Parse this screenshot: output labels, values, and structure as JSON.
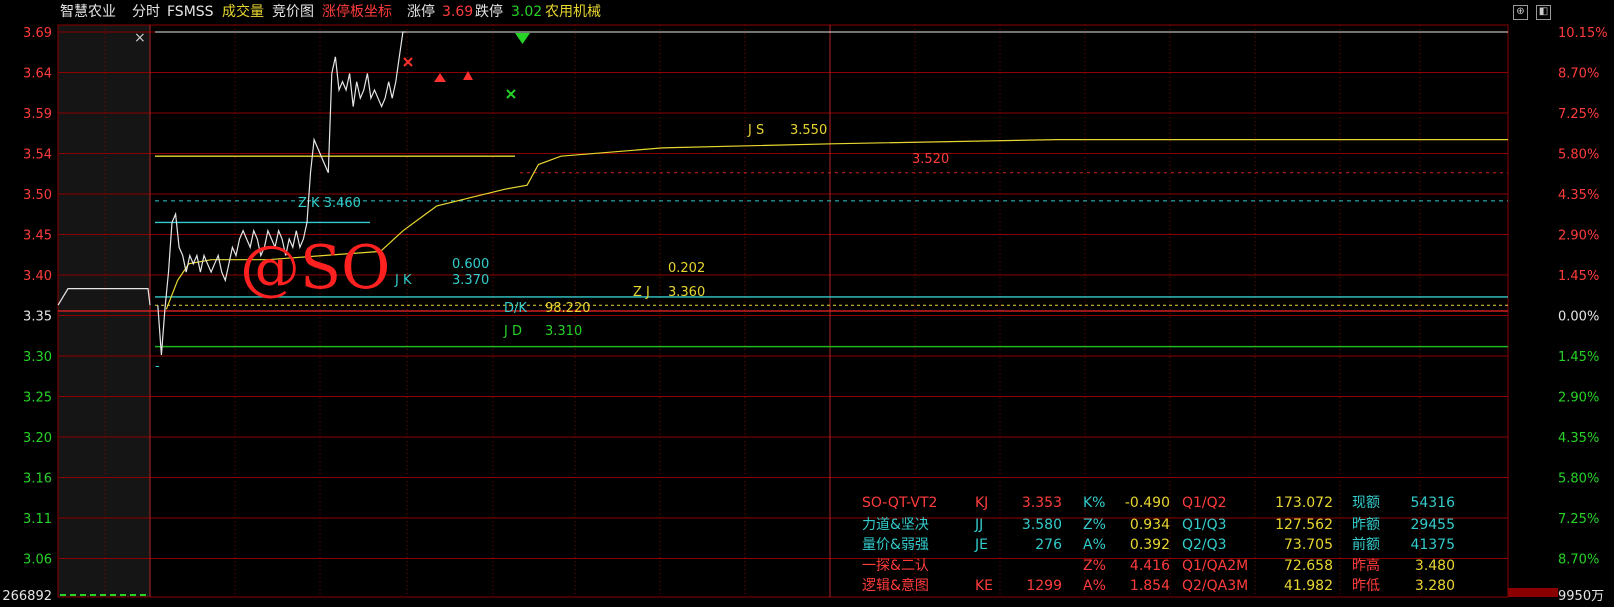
{
  "header": {
    "stock_name": "智慧农业",
    "mode": "分时",
    "indicator": "FSMSS",
    "volume_label": "成交量",
    "auction_label": "竞价图",
    "limit_board_label": "涨停板坐标",
    "limit_up_label": "涨停",
    "limit_up_value": "3.69",
    "limit_down_label": "跌停",
    "limit_down_value": "3.02",
    "sector": "农用机械"
  },
  "colors": {
    "background": "#000000",
    "price_line": "#e6e6e6",
    "avg_line": "#e8d630",
    "grid": "#8b0000",
    "up": "#ff3c3c",
    "down": "#27d327",
    "cyan": "#33cccc",
    "green_line": "#1fb51f"
  },
  "icons": {
    "close": "close-icon",
    "restore": "restore-icon",
    "maximize": "maximize-icon",
    "close_glyph": "×"
  },
  "chart_data": {
    "type": "line",
    "prev_close": 3.353,
    "ylim": [
      3.02,
      3.69
    ],
    "y_ticks_left": [
      "3.69",
      "3.64",
      "3.59",
      "3.54",
      "3.50",
      "3.45",
      "3.40",
      "3.35",
      "3.30",
      "3.25",
      "3.20",
      "3.16",
      "3.11",
      "3.06"
    ],
    "y_ticks_right": [
      "10.15%",
      "8.70%",
      "7.25%",
      "5.80%",
      "4.35%",
      "2.90%",
      "1.45%",
      "0.00%",
      "1.45%",
      "2.90%",
      "4.35%",
      "5.80%",
      "7.25%",
      "8.70%"
    ],
    "volume_axis_label": "266892",
    "volume_axis_right": "9950万",
    "series": [
      {
        "name": "price",
        "points": [
          [
            0,
            3.36
          ],
          [
            1,
            3.3
          ],
          [
            2,
            3.355
          ],
          [
            3,
            3.4
          ],
          [
            4,
            3.46
          ],
          [
            5,
            3.47
          ],
          [
            6,
            3.43
          ],
          [
            7,
            3.42
          ],
          [
            8,
            3.4
          ],
          [
            9,
            3.42
          ],
          [
            10,
            3.41
          ],
          [
            11,
            3.42
          ],
          [
            12,
            3.4
          ],
          [
            13,
            3.42
          ],
          [
            14,
            3.41
          ],
          [
            15,
            3.4
          ],
          [
            16,
            3.41
          ],
          [
            17,
            3.42
          ],
          [
            18,
            3.4
          ],
          [
            19,
            3.39
          ],
          [
            20,
            3.41
          ],
          [
            21,
            3.43
          ],
          [
            22,
            3.42
          ],
          [
            23,
            3.44
          ],
          [
            24,
            3.45
          ],
          [
            25,
            3.44
          ],
          [
            26,
            3.43
          ],
          [
            27,
            3.45
          ],
          [
            28,
            3.44
          ],
          [
            29,
            3.42
          ],
          [
            30,
            3.43
          ],
          [
            31,
            3.45
          ],
          [
            32,
            3.44
          ],
          [
            33,
            3.43
          ],
          [
            34,
            3.45
          ],
          [
            35,
            3.44
          ],
          [
            36,
            3.42
          ],
          [
            37,
            3.44
          ],
          [
            38,
            3.43
          ],
          [
            39,
            3.45
          ],
          [
            40,
            3.43
          ],
          [
            41,
            3.44
          ],
          [
            42,
            3.46
          ],
          [
            43,
            3.52
          ],
          [
            44,
            3.56
          ],
          [
            45,
            3.55
          ],
          [
            46,
            3.54
          ],
          [
            47,
            3.53
          ],
          [
            48,
            3.52
          ],
          [
            49,
            3.64
          ],
          [
            50,
            3.66
          ],
          [
            51,
            3.62
          ],
          [
            52,
            3.63
          ],
          [
            53,
            3.62
          ],
          [
            54,
            3.64
          ],
          [
            55,
            3.6
          ],
          [
            56,
            3.63
          ],
          [
            57,
            3.61
          ],
          [
            58,
            3.62
          ],
          [
            59,
            3.64
          ],
          [
            60,
            3.61
          ],
          [
            61,
            3.62
          ],
          [
            62,
            3.61
          ],
          [
            63,
            3.6
          ],
          [
            64,
            3.61
          ],
          [
            65,
            3.63
          ],
          [
            66,
            3.61
          ],
          [
            67,
            3.63
          ],
          [
            68,
            3.66
          ],
          [
            69,
            3.69
          ],
          [
            70,
            3.69
          ]
        ]
      },
      {
        "name": "avg",
        "points": [
          [
            2,
            3.355
          ],
          [
            4,
            3.39
          ],
          [
            6,
            3.41
          ],
          [
            10,
            3.415
          ],
          [
            20,
            3.415
          ],
          [
            30,
            3.42
          ],
          [
            40,
            3.425
          ],
          [
            44,
            3.45
          ],
          [
            48,
            3.47
          ],
          [
            50,
            3.48
          ],
          [
            56,
            3.49
          ],
          [
            62,
            3.5
          ],
          [
            66,
            3.505
          ],
          [
            68,
            3.53
          ],
          [
            72,
            3.54
          ],
          [
            90,
            3.55
          ],
          [
            120,
            3.555
          ],
          [
            160,
            3.56
          ],
          [
            200,
            3.56
          ],
          [
            240,
            3.56
          ]
        ]
      }
    ],
    "levels": [
      {
        "name": "涨停",
        "value": 3.69
      },
      {
        "name": "3.520",
        "value": 3.52,
        "label": "3.520"
      },
      {
        "name": "ZK",
        "value": 3.46,
        "label": "ZK 3.460"
      },
      {
        "name": "JK",
        "value": 3.37,
        "label": "JK"
      },
      {
        "name": "JD",
        "value": 3.31,
        "label": "JD"
      },
      {
        "name": "JS",
        "value": 3.55,
        "label": "JS"
      }
    ]
  },
  "annotations": {
    "watermark": "@SO",
    "zk": "Z K  3.460",
    "jk_label": "J K",
    "jk_top": "0.600",
    "jk_value": "3.370",
    "js_label": "J S",
    "js_value": "3.550",
    "zj_top": "0.202",
    "zj_label": "Z J",
    "zj_value": "3.360",
    "dk_label": "D/K",
    "dk_value": "98.220",
    "jd_label": "J D",
    "jd_value": "3.310",
    "level_3520": "3.520",
    "small_tick": "-"
  },
  "stats": {
    "rows": [
      [
        "SO-QT-VT2",
        "KJ",
        "3.353",
        "K%",
        "-0.490",
        "Q1/Q2",
        "173.072",
        "现额",
        "54316"
      ],
      [
        "力道&坚决",
        "JJ",
        "3.580",
        "Z%",
        "0.934",
        "Q1/Q3",
        "127.562",
        "昨额",
        "29455"
      ],
      [
        "量价&弱强",
        "JE",
        "276",
        "A%",
        "0.392",
        "Q2/Q3",
        "73.705",
        "前额",
        "41375"
      ],
      [
        "一探&二认",
        "",
        "",
        "Z%",
        "4.416",
        "Q1/QA2M",
        "72.658",
        "昨高",
        "3.480"
      ],
      [
        "逻辑&意图",
        "KE",
        "1299",
        "A%",
        "1.854",
        "Q2/QA3M",
        "41.982",
        "昨低",
        "3.280"
      ]
    ]
  }
}
